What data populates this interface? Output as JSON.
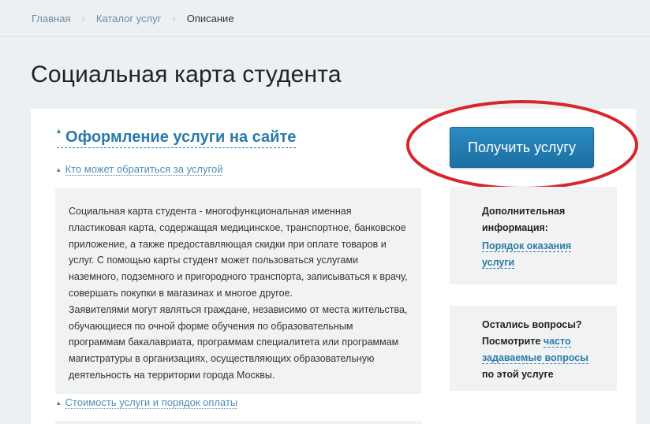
{
  "breadcrumb": {
    "home": "Главная",
    "catalog": "Каталог услуг",
    "current": "Описание"
  },
  "page": {
    "title": "Социальная карта студента"
  },
  "main": {
    "section_title": "Оформление услуги на сайте",
    "who_can_apply": "Кто может обратиться за услугой",
    "description_p1": "Социальная карта студента - многофункциональная именная пластиковая карта, содержащая медицинское, транспортное, банковское приложение, а также предоставляющая скидки при оплате товаров и услуг. С помощью карты студент может пользоваться услугами наземного, подземного и пригородного транспорта, записываться к врачу, совершать покупки в магазинах и многое другое.",
    "description_p2": "Заявителями могут являться граждане, независимо от места жительства, обучающиеся по очной форме обучения по образовательным программам бакалавриата, программам специалитета или программам магистратуры в организациях, осуществляющих образовательную деятельность на территории города Москвы.",
    "cost_link": "Стоимость услуги и порядок оплаты"
  },
  "sidebar": {
    "get_service_button": "Получить услугу",
    "info_title": "Дополнительная информация:",
    "info_link": "Порядок оказания услуги",
    "faq_question": "Остались вопросы?",
    "faq_see": "Посмотрите",
    "faq_link": "часто задаваемые вопросы",
    "faq_suffix": "по этой услуге"
  },
  "colors": {
    "accent": "#2b7aa8",
    "button": "#1f78ad",
    "highlight_ellipse": "#d8262b",
    "faq_icon": "#7aa22c"
  },
  "icons": {
    "breadcrumb_separator": "chevron-right-icon",
    "expand_toggle": "caret-up-icon",
    "faq": "question-circle-icon"
  }
}
